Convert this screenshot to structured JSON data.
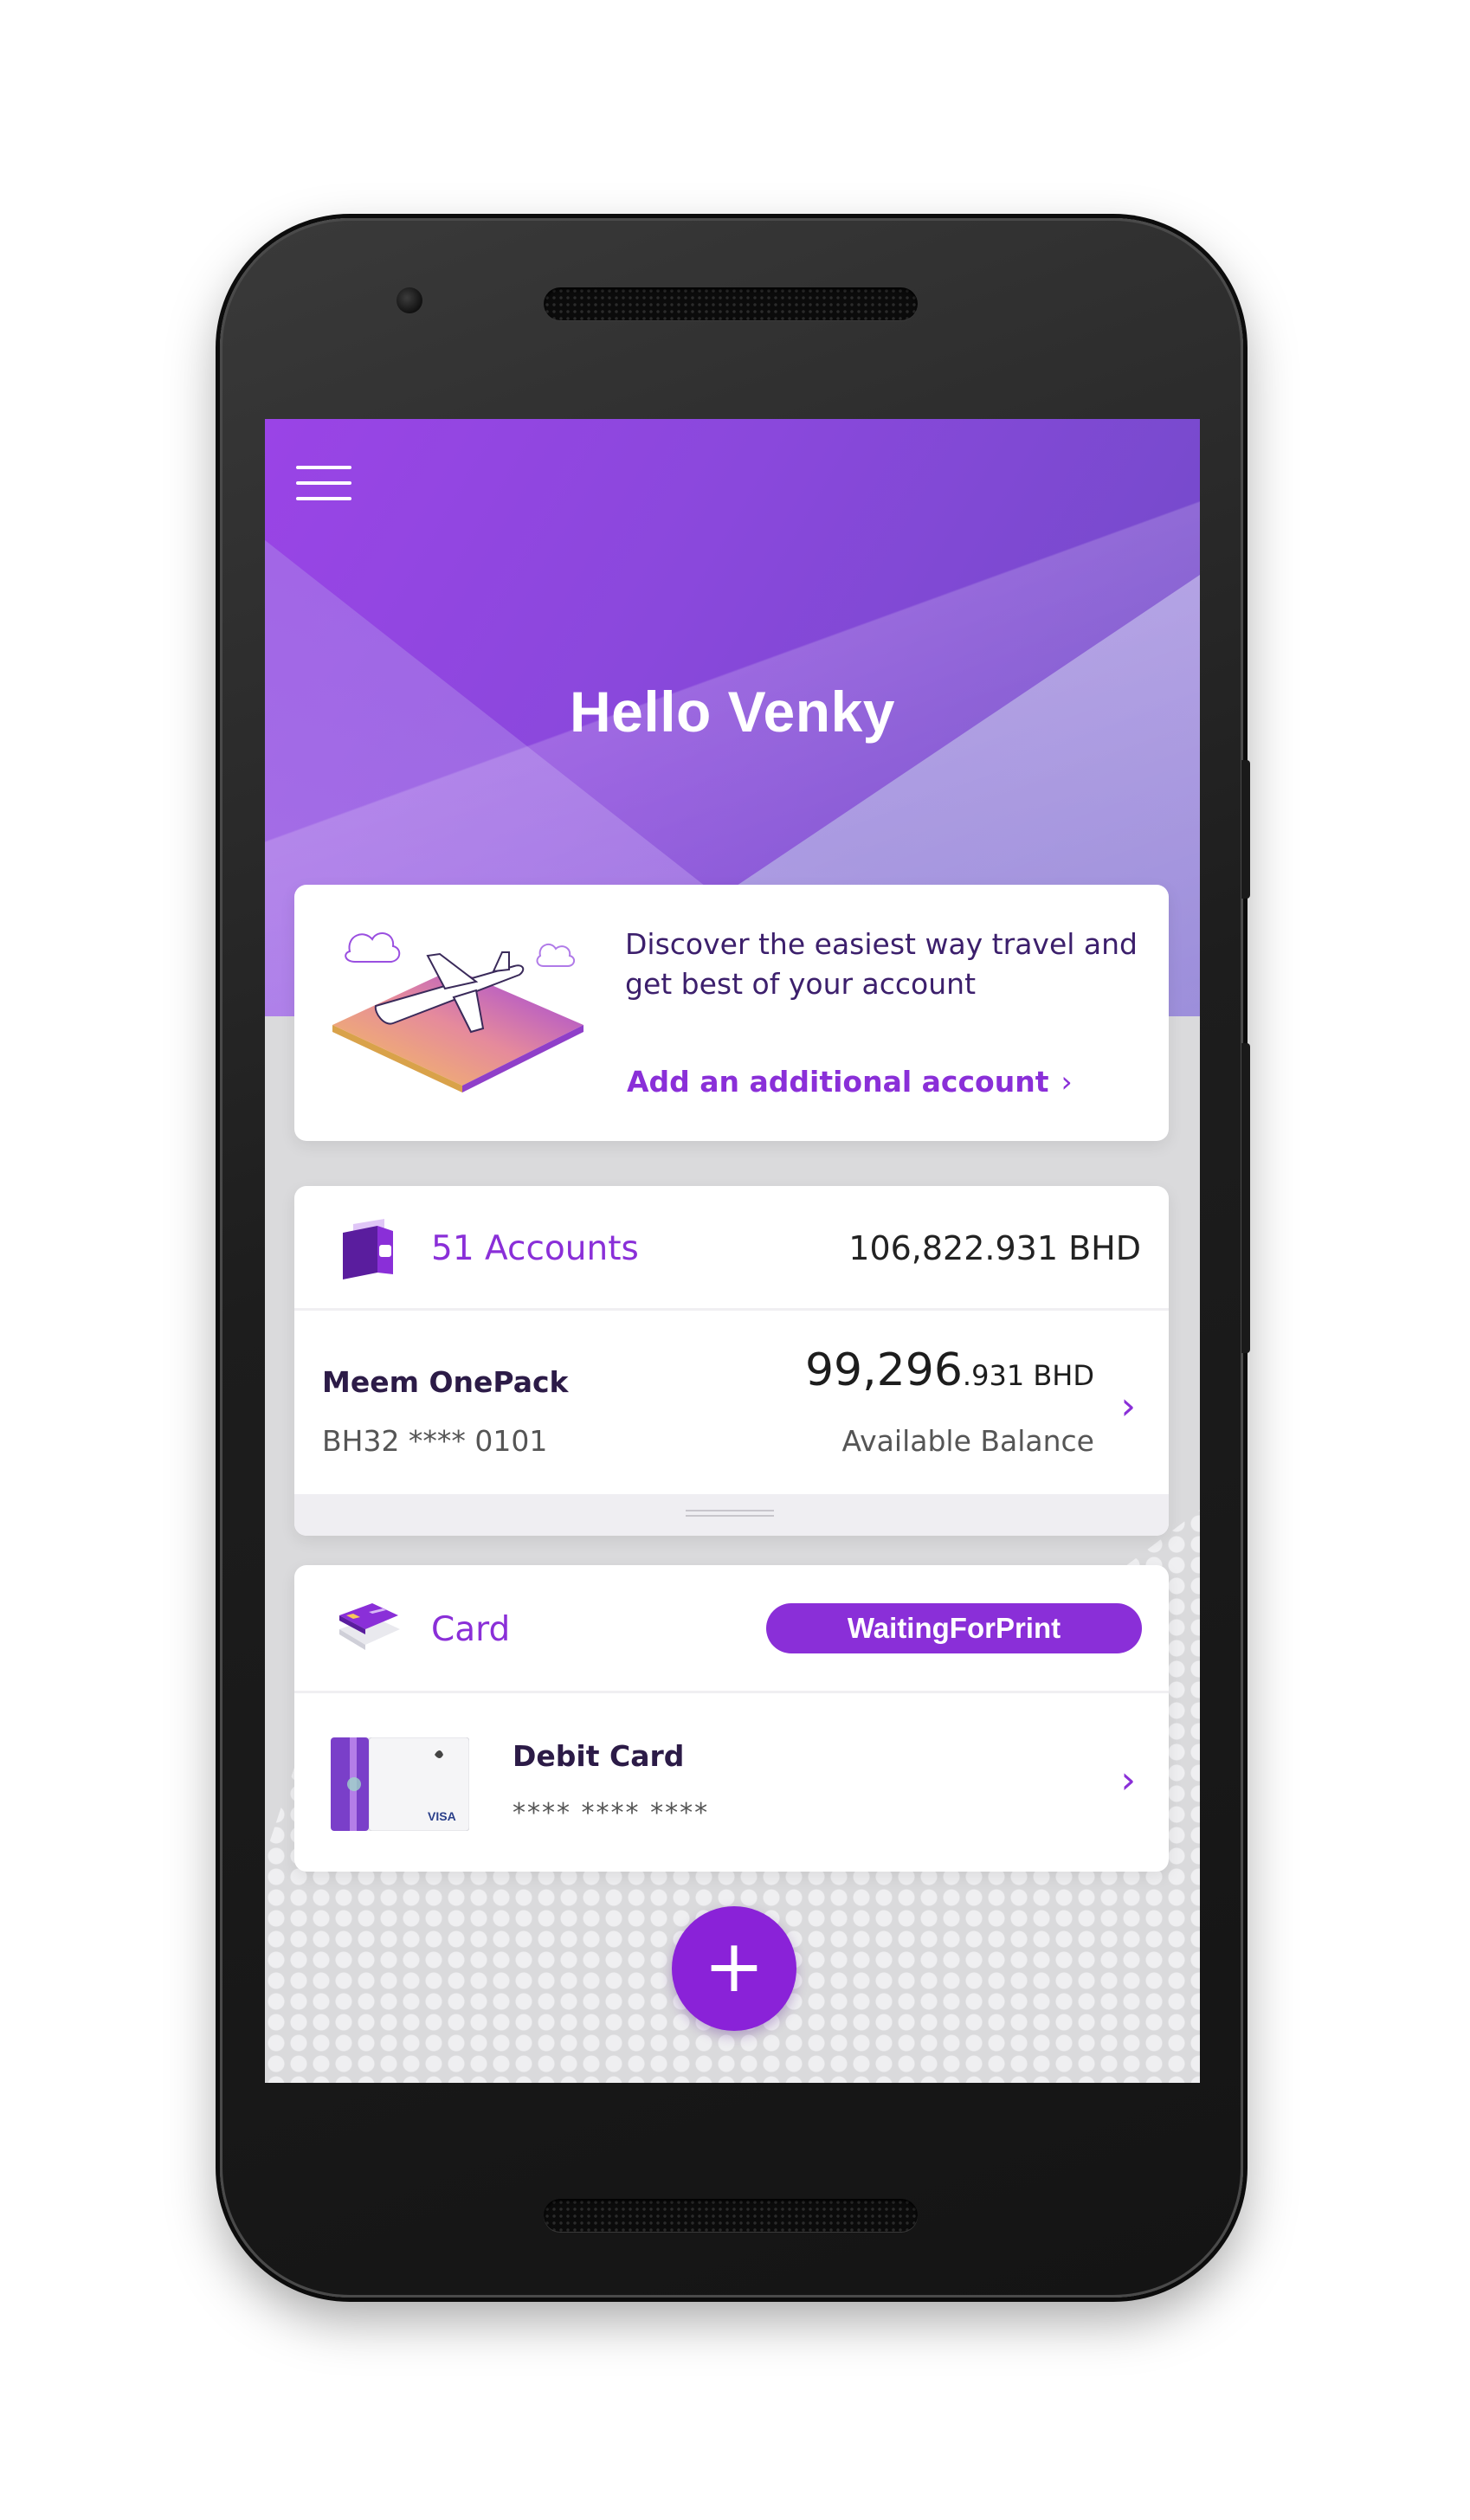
{
  "header": {
    "greeting": "Hello Venky"
  },
  "promo": {
    "text": "Discover the easiest way travel and get best of your account",
    "link_label": "Add an additional account",
    "link_chevron": "›"
  },
  "accounts": {
    "count_label": "51 Accounts",
    "total": "106,822.931 BHD",
    "item": {
      "name": "Meem OnePack",
      "iban": "BH32 **** 0101",
      "balance_major": "99,296",
      "balance_minor": ".931 BHD",
      "balance_label": "Available Balance",
      "chevron": "›"
    }
  },
  "cards": {
    "title": "Card",
    "status": "WaitingForPrint",
    "item": {
      "name": "Debit Card",
      "masked_number": "**** **** ****",
      "chevron": "›"
    }
  },
  "fab": {
    "label": "+"
  },
  "colors": {
    "brand_purple": "#8a2fd8",
    "header_gradient_start": "#9a44e6",
    "header_gradient_end": "#6c4bc4"
  },
  "icons": [
    "menu-icon",
    "airplane-illustration",
    "wallet-icon",
    "credit-card-icon",
    "debit-card-thumbnail",
    "chevron-right-icon",
    "plus-icon"
  ]
}
